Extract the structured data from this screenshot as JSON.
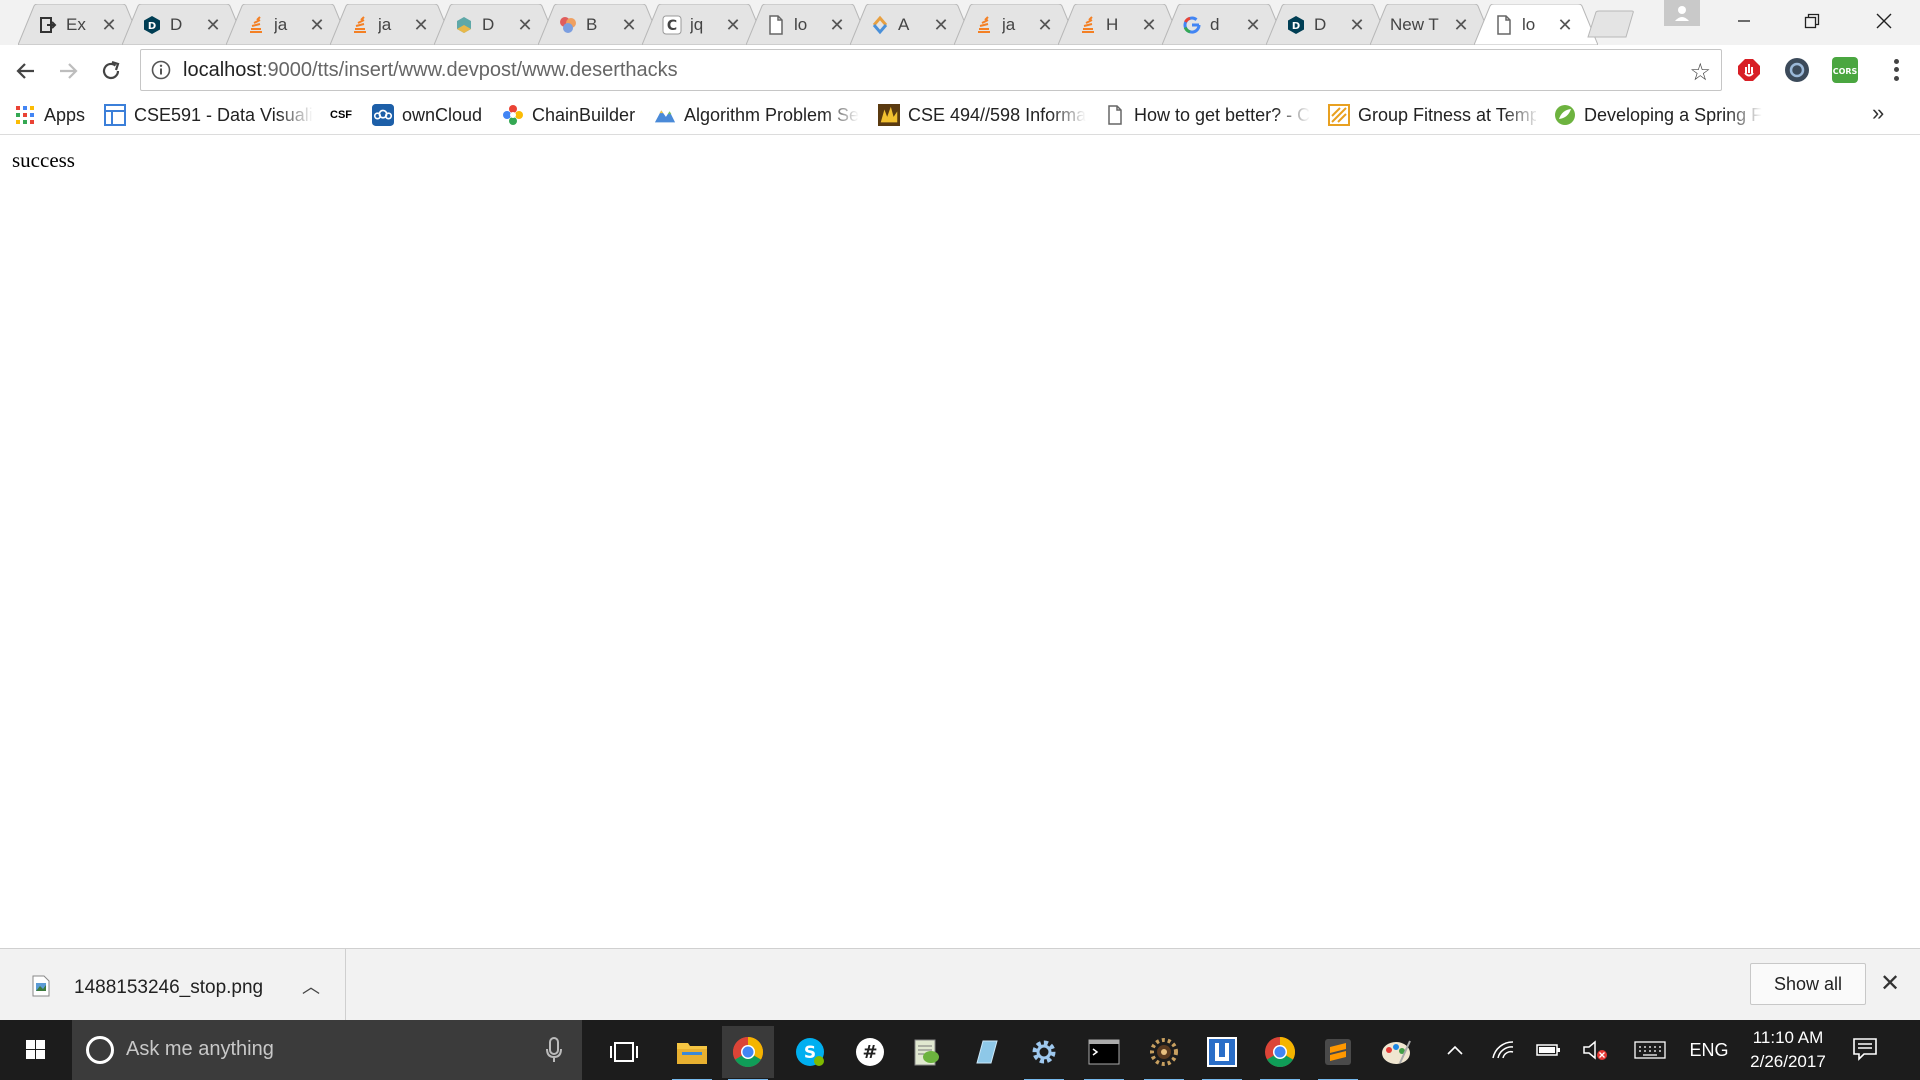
{
  "tabs": [
    {
      "title": "Ex",
      "favicon": "ex-icon",
      "color": "#333333"
    },
    {
      "title": "D",
      "favicon": "devpost-icon",
      "color": "#003e54"
    },
    {
      "title": "ja",
      "favicon": "stackoverflow-icon",
      "color": "#f48024"
    },
    {
      "title": "ja",
      "favicon": "stackoverflow-icon",
      "color": "#f48024"
    },
    {
      "title": "D",
      "favicon": "hex-icon",
      "color": "#5fa8a8"
    },
    {
      "title": "B",
      "favicon": "balls-icon",
      "color": "#e05d5d"
    },
    {
      "title": "jq",
      "favicon": "c-icon",
      "color": "#555555"
    },
    {
      "title": "lo",
      "favicon": "page-icon",
      "color": "#666666"
    },
    {
      "title": "A",
      "favicon": "arrow-icon",
      "color": "#4a90d9"
    },
    {
      "title": "ja",
      "favicon": "stackoverflow-icon",
      "color": "#f48024"
    },
    {
      "title": "H",
      "favicon": "stackoverflow-icon",
      "color": "#f48024"
    },
    {
      "title": "d",
      "favicon": "google-icon",
      "color": "#4285f4"
    },
    {
      "title": "D",
      "favicon": "devpost-icon",
      "color": "#003e54"
    },
    {
      "title": "New T",
      "favicon": "",
      "color": "#666666"
    },
    {
      "title": "lo",
      "favicon": "page-icon",
      "color": "#666666",
      "active": true
    }
  ],
  "address": {
    "host": "localhost",
    "path": ":9000/tts/insert/www.devpost/www.deserthacks"
  },
  "bookmarks": [
    {
      "label": "Apps",
      "icon": "apps-grid-icon"
    },
    {
      "label": "CSE591 - Data Visuali",
      "icon": "blue-square-icon"
    },
    {
      "label": "",
      "icon": "csf-icon",
      "icon_text": "CSF"
    },
    {
      "label": "ownCloud",
      "icon": "owncloud-icon"
    },
    {
      "label": "ChainBuilder",
      "icon": "chainbuilder-icon"
    },
    {
      "label": "Algorithm Problem Se",
      "icon": "algorithm-icon"
    },
    {
      "label": "CSE 494//598 Informa",
      "icon": "cse-icon"
    },
    {
      "label": "How to get better? - C",
      "icon": "page-icon"
    },
    {
      "label": "Group Fitness at Temp",
      "icon": "fitness-icon"
    },
    {
      "label": "Developing a Spring F",
      "icon": "spring-icon"
    }
  ],
  "page": {
    "message": "success"
  },
  "download": {
    "filename": "1488153246_stop.png",
    "show_all": "Show all"
  },
  "taskbar": {
    "search_placeholder": "Ask me anything",
    "language": "ENG",
    "time": "11:10 AM",
    "date": "2/26/2017"
  },
  "colors": {
    "tabstrip": "#f2f2f2",
    "taskbar": "#1c1c1c",
    "accent": "#76b9ed"
  }
}
